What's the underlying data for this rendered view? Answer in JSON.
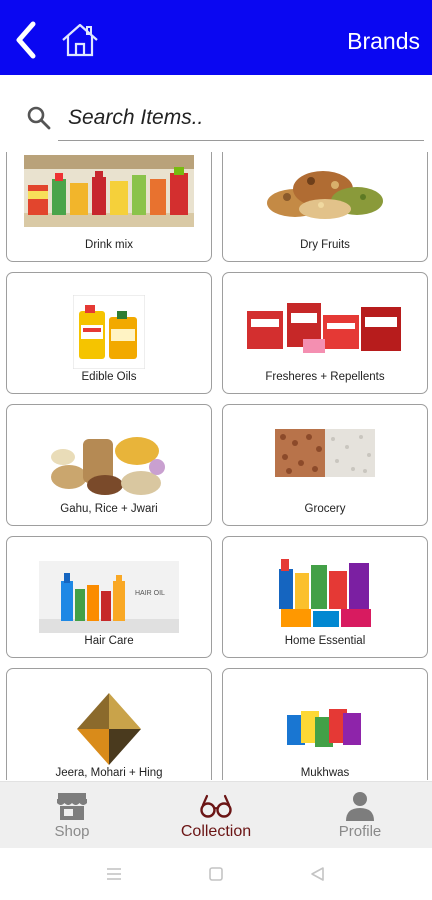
{
  "header": {
    "title": "Brands",
    "back_icon": "chevron-left-icon",
    "home_icon": "home-icon",
    "bg_color": "#0a07f2"
  },
  "search": {
    "placeholder": "Search Items..",
    "value": "",
    "icon": "search-icon"
  },
  "categories": [
    {
      "label": "Drink mix",
      "icon": "drink-bottles-image"
    },
    {
      "label": "Dry Fruits",
      "icon": "dry-fruits-image"
    },
    {
      "label": "Edible Oils",
      "icon": "oil-bottles-image"
    },
    {
      "label": "Fresheres + Repellents",
      "icon": "repellent-boxes-image"
    },
    {
      "label": "Gahu, Rice + Jwari",
      "icon": "grains-sacks-image"
    },
    {
      "label": "Grocery",
      "icon": "grocery-grains-image"
    },
    {
      "label": "Hair Care",
      "icon": "hair-oil-bottles-image"
    },
    {
      "label": "Home Essential",
      "icon": "home-products-image"
    },
    {
      "label": "Jeera, Mohari + Hing",
      "icon": "spices-image"
    },
    {
      "label": "Mukhwas",
      "icon": "mukhwas-packets-image"
    }
  ],
  "bottom_nav": [
    {
      "label": "Shop",
      "icon": "shop-icon",
      "active": false
    },
    {
      "label": "Collection",
      "icon": "glasses-icon",
      "active": true
    },
    {
      "label": "Profile",
      "icon": "profile-icon",
      "active": false
    }
  ],
  "colors": {
    "accent": "#0a07f2",
    "active_nav": "#6b1515",
    "inactive_nav": "#8a8a8a"
  }
}
